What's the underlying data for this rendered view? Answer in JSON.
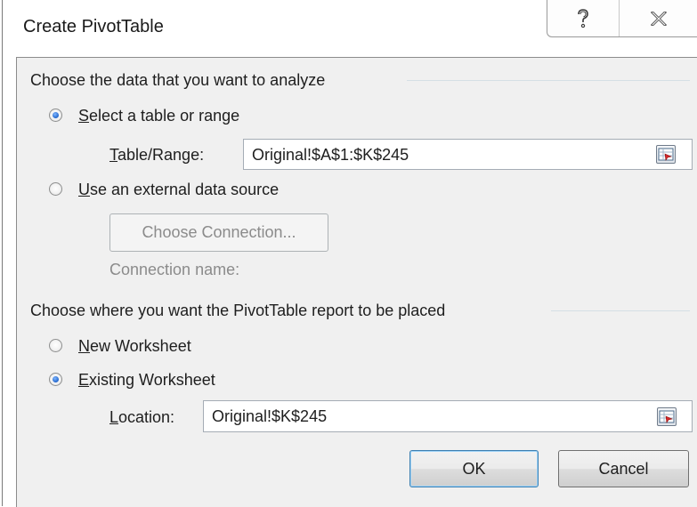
{
  "window": {
    "title": "Create PivotTable",
    "help_icon": "question-mark-icon",
    "close_icon": "close-x-icon"
  },
  "data_section": {
    "heading": "Choose the data that you want to analyze",
    "option_range": {
      "label": "Select a table or range",
      "accesskey": "S",
      "selected": true
    },
    "range_field": {
      "label": "Table/Range:",
      "value": "Original!$A$1:$K$245"
    },
    "option_external": {
      "label": "Use an external data source",
      "accesskey": "U",
      "selected": false
    },
    "choose_connection_button": "Choose Connection...",
    "connection_name_label": "Connection name:"
  },
  "placement_section": {
    "heading": "Choose where you want the PivotTable report to be placed",
    "option_new": {
      "label": "New Worksheet",
      "accesskey": "N",
      "selected": false
    },
    "option_existing": {
      "label": "Existing Worksheet",
      "accesskey": "E",
      "selected": true
    },
    "location_field": {
      "label": "Location:",
      "value": "Original!$K$245"
    }
  },
  "buttons": {
    "ok": "OK",
    "cancel": "Cancel"
  },
  "colors": {
    "dialog_bg": "#f0f0f0",
    "radio_dot": "#2266cc",
    "group_line": "#d5dfe5"
  }
}
